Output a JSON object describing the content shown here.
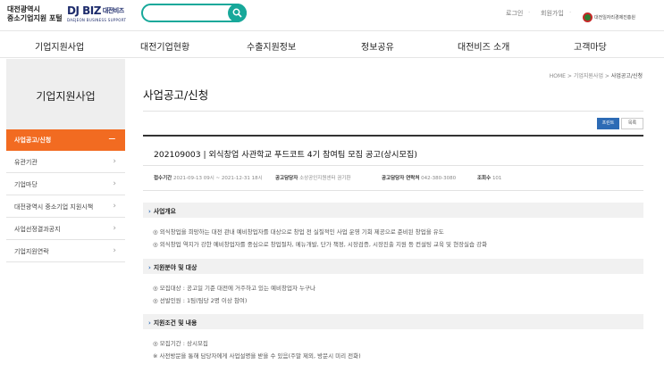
{
  "header": {
    "logo_line1": "대전광역시",
    "logo_line2": "중소기업지원 포털",
    "djbiz_logo": "DJ BIZ",
    "djbiz_kr": "대전비즈",
    "djbiz_sub": "DAEJEON BUSINESS SUPPORT",
    "search_placeholder": "",
    "util_login": "로그인",
    "util_join": "회원가입",
    "partner_text": "대전일자리경제진흥원",
    "colors": {
      "accent_teal": "#17a89a",
      "accent_orange": "#f26b21",
      "accent_blue": "#2d6bb5"
    }
  },
  "gnb": [
    "기업지원사업",
    "대전기업현황",
    "수출지원정보",
    "정보공유",
    "대전비즈 소개",
    "고객마당"
  ],
  "sidebar": {
    "title": "기업지원사업",
    "items": [
      {
        "label": "사업공고/신청",
        "active": true
      },
      {
        "label": "유관기관",
        "active": false
      },
      {
        "label": "기업마당",
        "active": false
      },
      {
        "label": "대전광역시 중소기업 지원시책",
        "active": false
      },
      {
        "label": "사업선정결과공지",
        "active": false
      },
      {
        "label": "기업지원연락",
        "active": false
      }
    ]
  },
  "breadcrumb": {
    "home": "HOME",
    "level1": "기업지원사업",
    "level2": "사업공고/신청",
    "sep": ">"
  },
  "page_title": "사업공고/신청",
  "buttons": {
    "print": "프린트",
    "list": "목록"
  },
  "post": {
    "title": "202109003 | 외식창업 사관학교 푸드코트 4기 참여팀 모집 공고(상시모집)",
    "meta": {
      "period_label": "접수기간",
      "period_value": "2021-09-13 09시 ~ 2021-12-31 18시",
      "manager_label": "공고담당자",
      "manager_value": "소상공인지원센터 권기환",
      "contact_label": "공고담당자 연락처",
      "contact_value": "042-380-3080",
      "views_label": "조회수",
      "views_value": "101"
    },
    "sections": [
      {
        "heading": "사업개요",
        "lines": [
          "◎ 외식창업을 희망하는 대전 관내 예비창업자를 대상으로 창업 전 실질적인 사업 운영 기회 제공으로 준비된 창업을 유도",
          "◎ 외식창업 역지가 강한 예비창업자를 중심으로 창업절차, 메뉴개발, 단가 책정, 시장검증, 시장진출 지원 등 컨설팅 교육 및 현장실습 강화"
        ]
      },
      {
        "heading": "지원분야 및 대상",
        "lines": [
          "◎ 모집대상 : 공고일 기준 대전에 거주하고 있는 예비창업자 누구나",
          "◎ 선발인원 : 1팀(팀당 2명 이상 참여)"
        ]
      },
      {
        "heading": "지원조건 및 내용",
        "lines": [
          "◎ 모집기간 : 상시모집",
          "※ 사전방문을 통해 담당자에게 사업설명을 받을 수 있음(주말 제외, 방문시 미리 전화)"
        ]
      }
    ]
  }
}
